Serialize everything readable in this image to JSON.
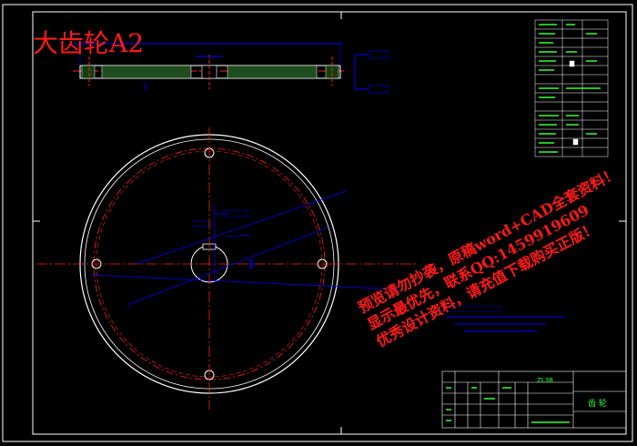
{
  "title": "大齿轮A2",
  "watermark_lines": [
    "预览请勿抄袭，原稿word+CAD全套资料！",
    "显示最优先，联系QQ:1459919609",
    "优秀设计资料，请充值下载购买正版！"
  ],
  "title_block": {
    "part_name": "ZL3B",
    "drawing_label": "齿 轮"
  },
  "colors": {
    "background": "#000000",
    "outline": "#ffffff",
    "dimension": "#0000ff",
    "centerline": "#ff2020",
    "table_text": "#33ff33",
    "watermark": "#ff1a1a"
  }
}
